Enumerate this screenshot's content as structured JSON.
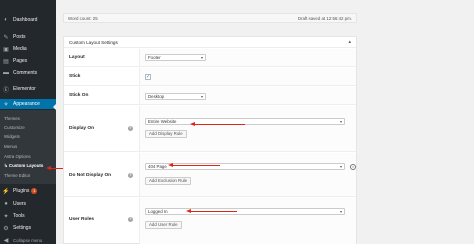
{
  "sidebar": {
    "items": [
      {
        "label": "Dashboard",
        "icon": "dashboard-icon",
        "glyph": "◐"
      },
      {
        "label": "Posts",
        "icon": "pin-icon",
        "glyph": "✎"
      },
      {
        "label": "Media",
        "icon": "media-icon",
        "glyph": "▣"
      },
      {
        "label": "Pages",
        "icon": "pages-icon",
        "glyph": "▤"
      },
      {
        "label": "Comments",
        "icon": "comments-icon",
        "glyph": "▬"
      },
      {
        "label": "Elementor",
        "icon": "elementor-icon",
        "glyph": "Ⓔ"
      },
      {
        "label": "Appearance",
        "icon": "appearance-icon",
        "glyph": "✧"
      }
    ],
    "submenu": [
      "Themes",
      "Customize",
      "Widgets",
      "Menus",
      "Astra Options",
      "Custom Layouts",
      "Theme Editor"
    ],
    "lower_items": [
      {
        "label": "Plugins",
        "icon": "plugins-icon",
        "glyph": "⚡",
        "badge": "1"
      },
      {
        "label": "Users",
        "icon": "users-icon",
        "glyph": "●"
      },
      {
        "label": "Tools",
        "icon": "tools-icon",
        "glyph": "✦"
      },
      {
        "label": "Settings",
        "icon": "settings-icon",
        "glyph": "⚙"
      },
      {
        "label": "Collapse menu",
        "icon": "collapse-icon",
        "glyph": "◀"
      }
    ]
  },
  "editor": {
    "word_count": "Word count: 25",
    "draft_saved": "Draft saved at 12:56:42 pm."
  },
  "metabox": {
    "title": "Custom Layout Settings",
    "toggle": "▴",
    "layout": {
      "label": "Layout",
      "value": "Footer"
    },
    "stick": {
      "label": "Stick",
      "checked": true
    },
    "stick_on": {
      "label": "Stick On",
      "value": "Desktop"
    },
    "display_on": {
      "label": "Display On",
      "value": "Entire Website",
      "button": "Add Display Rule"
    },
    "not_display_on": {
      "label": "Do Not Display On",
      "value": "404 Page",
      "button": "Add Exclusion Rule"
    },
    "user_roles": {
      "label": "User Roles",
      "value": "Logged In",
      "button": "Add User Rule"
    }
  },
  "colors": {
    "sidebar": "#23282d",
    "active": "#0073aa",
    "arrow": "#e0261b"
  }
}
